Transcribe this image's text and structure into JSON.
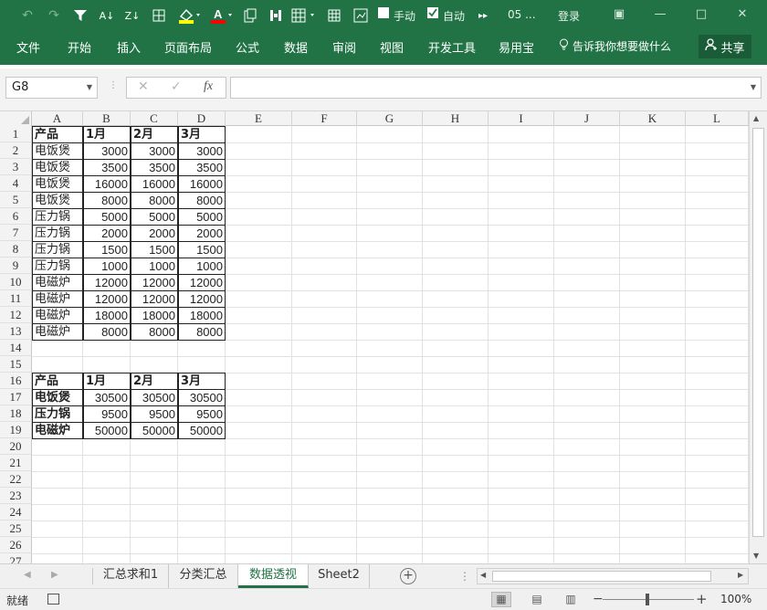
{
  "quick_access": {
    "buttons": [
      "undo-icon",
      "redo-icon",
      "filter-icon",
      "sort-asc-icon",
      "sort-desc-icon",
      "borders-icon",
      "fill-color-icon",
      "font-color-icon",
      "paste-special-icon",
      "freeze-icon",
      "format-table-icon",
      "grid-icon",
      "refresh-icon"
    ],
    "manual_label": "手动",
    "auto_label": "自动",
    "file_title": "05 ...",
    "login_label": "登录"
  },
  "ribbon": {
    "tabs": [
      "文件",
      "开始",
      "插入",
      "页面布局",
      "公式",
      "数据",
      "审阅",
      "视图",
      "开发工具",
      "易用宝"
    ],
    "tell_me": "告诉我你想要做什么",
    "share_label": "共享"
  },
  "formula_bar": {
    "name_box": "G8",
    "fx_label": "fx",
    "formula": ""
  },
  "columns": [
    "A",
    "B",
    "C",
    "D",
    "E",
    "F",
    "G",
    "H",
    "I",
    "J",
    "K",
    "L"
  ],
  "rows": [
    "1",
    "2",
    "3",
    "4",
    "5",
    "6",
    "7",
    "8",
    "9",
    "10",
    "11",
    "12",
    "13",
    "14",
    "15",
    "16",
    "17",
    "18",
    "19",
    "20",
    "21",
    "22",
    "23",
    "24",
    "25",
    "26",
    "27"
  ],
  "table1": {
    "headers": [
      "产品",
      "1月",
      "2月",
      "3月"
    ],
    "rows": [
      [
        "电饭煲",
        "3000",
        "3000",
        "3000"
      ],
      [
        "电饭煲",
        "3500",
        "3500",
        "3500"
      ],
      [
        "电饭煲",
        "16000",
        "16000",
        "16000"
      ],
      [
        "电饭煲",
        "8000",
        "8000",
        "8000"
      ],
      [
        "压力锅",
        "5000",
        "5000",
        "5000"
      ],
      [
        "压力锅",
        "2000",
        "2000",
        "2000"
      ],
      [
        "压力锅",
        "1500",
        "1500",
        "1500"
      ],
      [
        "压力锅",
        "1000",
        "1000",
        "1000"
      ],
      [
        "电磁炉",
        "12000",
        "12000",
        "12000"
      ],
      [
        "电磁炉",
        "12000",
        "12000",
        "12000"
      ],
      [
        "电磁炉",
        "18000",
        "18000",
        "18000"
      ],
      [
        "电磁炉",
        "8000",
        "8000",
        "8000"
      ]
    ]
  },
  "table2": {
    "headers": [
      "产品",
      "1月",
      "2月",
      "3月"
    ],
    "rows": [
      [
        "电饭煲",
        "30500",
        "30500",
        "30500"
      ],
      [
        "压力锅",
        "9500",
        "9500",
        "9500"
      ],
      [
        "电磁炉",
        "50000",
        "50000",
        "50000"
      ]
    ]
  },
  "sheets": {
    "tabs": [
      "汇总求和1",
      "分类汇总",
      "数据透视",
      "Sheet2"
    ],
    "active": "数据透视"
  },
  "status": {
    "ready": "就绪",
    "zoom": "100%"
  },
  "colors": {
    "brand": "#217346",
    "share_bg": "#1a5c38"
  }
}
